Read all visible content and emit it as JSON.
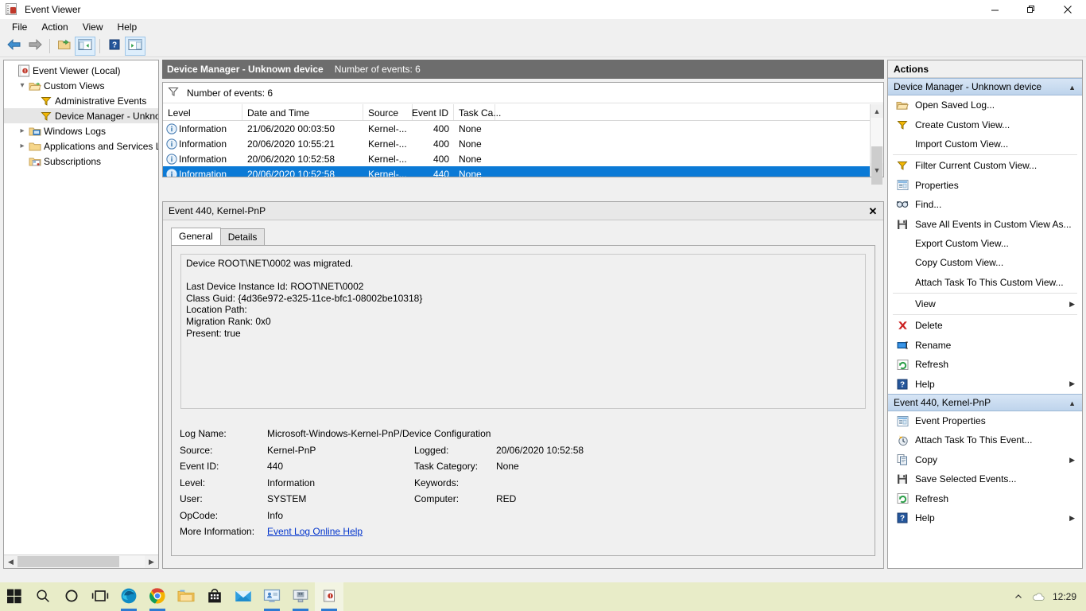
{
  "window": {
    "title": "Event Viewer",
    "icon": "event-viewer-icon",
    "controls": {
      "minimize": "minimize-icon",
      "restore": "restore-icon",
      "close": "close-icon"
    }
  },
  "menubar": {
    "items": [
      "File",
      "Action",
      "View",
      "Help"
    ]
  },
  "toolbar": {
    "buttons": [
      {
        "name": "back-button",
        "icon": "back-arrow-icon",
        "framed": false
      },
      {
        "name": "forward-button",
        "icon": "forward-arrow-icon",
        "framed": false
      },
      {
        "name": "up-folder-button",
        "icon": "folder-up-icon",
        "framed": false
      },
      {
        "name": "show-hide-console-tree-button",
        "icon": "console-tree-icon",
        "framed": true
      },
      {
        "name": "help-button",
        "icon": "help-icon",
        "framed": false
      },
      {
        "name": "show-hide-action-pane-button",
        "icon": "action-pane-icon",
        "framed": true
      }
    ]
  },
  "tree": {
    "items": [
      {
        "label": "Event Viewer (Local)",
        "indent": 0,
        "twisty": "",
        "icon": "event-viewer-icon",
        "selected": false
      },
      {
        "label": "Custom Views",
        "indent": 1,
        "twisty": "v",
        "icon": "folder-open-icon",
        "selected": false
      },
      {
        "label": "Administrative Events",
        "indent": 2,
        "twisty": "",
        "icon": "filter-icon",
        "selected": false
      },
      {
        "label": "Device Manager - Unkno",
        "indent": 2,
        "twisty": "",
        "icon": "filter-icon",
        "selected": true
      },
      {
        "label": "Windows Logs",
        "indent": 1,
        "twisty": ">",
        "icon": "logs-folder-icon",
        "selected": false
      },
      {
        "label": "Applications and Services Lo",
        "indent": 1,
        "twisty": ">",
        "icon": "folder-icon",
        "selected": false
      },
      {
        "label": "Subscriptions",
        "indent": 1,
        "twisty": "",
        "icon": "subscriptions-icon",
        "selected": false
      }
    ]
  },
  "center": {
    "header": {
      "title": "Device Manager - Unknown device",
      "subtitle": "Number of events: 6"
    },
    "filter_row": {
      "icon": "filter-icon",
      "text": "Number of events: 6"
    },
    "columns": [
      "Level",
      "Date and Time",
      "Source",
      "Event ID",
      "Task Ca..."
    ],
    "rows": [
      {
        "level": "Information",
        "datetime": "21/06/2020 00:03:50",
        "source": "Kernel-...",
        "event_id": "400",
        "task_category": "None",
        "selected": false
      },
      {
        "level": "Information",
        "datetime": "20/06/2020 10:55:21",
        "source": "Kernel-...",
        "event_id": "400",
        "task_category": "None",
        "selected": false
      },
      {
        "level": "Information",
        "datetime": "20/06/2020 10:52:58",
        "source": "Kernel-...",
        "event_id": "400",
        "task_category": "None",
        "selected": false
      },
      {
        "level": "Information",
        "datetime": "20/06/2020 10:52:58",
        "source": "Kernel-...",
        "event_id": "440",
        "task_category": "None",
        "selected": true
      }
    ]
  },
  "details": {
    "title": "Event 440, Kernel-PnP",
    "close_icon": "close-icon",
    "tabs": [
      {
        "label": "General",
        "active": true
      },
      {
        "label": "Details",
        "active": false
      }
    ],
    "message": "Device ROOT\\NET\\0002 was migrated.\n\nLast Device Instance Id: ROOT\\NET\\0002\nClass Guid: {4d36e972-e325-11ce-bfc1-08002be10318}\nLocation Path:\nMigration Rank: 0x0\nPresent: true",
    "fields": {
      "log_name_label": "Log Name:",
      "log_name_value": "Microsoft-Windows-Kernel-PnP/Device Configuration",
      "source_label": "Source:",
      "source_value": "Kernel-PnP",
      "logged_label": "Logged:",
      "logged_value": "20/06/2020 10:52:58",
      "event_id_label": "Event ID:",
      "event_id_value": "440",
      "task_category_label": "Task Category:",
      "task_category_value": "None",
      "level_label": "Level:",
      "level_value": "Information",
      "keywords_label": "Keywords:",
      "keywords_value": "",
      "user_label": "User:",
      "user_value": "SYSTEM",
      "computer_label": "Computer:",
      "computer_value": "RED",
      "opcode_label": "OpCode:",
      "opcode_value": "Info",
      "more_information_label": "More Information:",
      "more_information_link": "Event Log Online Help"
    }
  },
  "actions": {
    "header": "Actions",
    "groups": [
      {
        "title": "Device Manager - Unknown device",
        "chevron": "chevron-up-icon",
        "items": [
          {
            "label": "Open Saved Log...",
            "icon": "open-folder-icon",
            "submenu": false,
            "sep_after": false
          },
          {
            "label": "Create Custom View...",
            "icon": "filter-icon",
            "submenu": false,
            "sep_after": false
          },
          {
            "label": "Import Custom View...",
            "icon": "",
            "submenu": false,
            "sep_after": true
          },
          {
            "label": "Filter Current Custom View...",
            "icon": "filter-icon",
            "submenu": false,
            "sep_after": false
          },
          {
            "label": "Properties",
            "icon": "properties-icon",
            "submenu": false,
            "sep_after": false
          },
          {
            "label": "Find...",
            "icon": "find-icon",
            "submenu": false,
            "sep_after": false
          },
          {
            "label": "Save All Events in Custom View As...",
            "icon": "save-icon",
            "submenu": false,
            "sep_after": false
          },
          {
            "label": "Export Custom View...",
            "icon": "",
            "submenu": false,
            "sep_after": false
          },
          {
            "label": "Copy Custom View...",
            "icon": "",
            "submenu": false,
            "sep_after": false
          },
          {
            "label": "Attach Task To This Custom View...",
            "icon": "",
            "submenu": false,
            "sep_after": true
          },
          {
            "label": "View",
            "icon": "",
            "submenu": true,
            "sep_after": true
          },
          {
            "label": "Delete",
            "icon": "delete-icon",
            "submenu": false,
            "sep_after": false
          },
          {
            "label": "Rename",
            "icon": "rename-icon",
            "submenu": false,
            "sep_after": false
          },
          {
            "label": "Refresh",
            "icon": "refresh-icon",
            "submenu": false,
            "sep_after": false
          },
          {
            "label": "Help",
            "icon": "help-icon",
            "submenu": true,
            "sep_after": false
          }
        ]
      },
      {
        "title": "Event 440, Kernel-PnP",
        "chevron": "chevron-up-icon",
        "items": [
          {
            "label": "Event Properties",
            "icon": "properties-icon",
            "submenu": false,
            "sep_after": false
          },
          {
            "label": "Attach Task To This Event...",
            "icon": "attach-task-icon",
            "submenu": false,
            "sep_after": false
          },
          {
            "label": "Copy",
            "icon": "copy-icon",
            "submenu": true,
            "sep_after": false
          },
          {
            "label": "Save Selected Events...",
            "icon": "save-icon",
            "submenu": false,
            "sep_after": false
          },
          {
            "label": "Refresh",
            "icon": "refresh-icon",
            "submenu": false,
            "sep_after": false
          },
          {
            "label": "Help",
            "icon": "help-icon",
            "submenu": true,
            "sep_after": false
          }
        ]
      }
    ]
  },
  "taskbar": {
    "items": [
      {
        "name": "start-button",
        "icon": "windows-logo-icon",
        "active": false,
        "running": false
      },
      {
        "name": "search-button",
        "icon": "search-icon",
        "active": false,
        "running": false
      },
      {
        "name": "cortana-button",
        "icon": "circle-icon",
        "active": false,
        "running": false
      },
      {
        "name": "task-view-button",
        "icon": "task-view-icon",
        "active": false,
        "running": false
      },
      {
        "name": "taskbar-edge",
        "icon": "edge-icon",
        "active": false,
        "running": true
      },
      {
        "name": "taskbar-chrome",
        "icon": "chrome-icon",
        "active": false,
        "running": true
      },
      {
        "name": "taskbar-file-explorer",
        "icon": "file-explorer-icon",
        "active": false,
        "running": false
      },
      {
        "name": "taskbar-microsoft-store",
        "icon": "store-icon",
        "active": false,
        "running": false
      },
      {
        "name": "taskbar-mail",
        "icon": "mail-icon",
        "active": false,
        "running": false
      },
      {
        "name": "taskbar-remote-desktop",
        "icon": "remote-desktop-icon",
        "active": false,
        "running": true
      },
      {
        "name": "taskbar-device-manager",
        "icon": "device-manager-icon",
        "active": false,
        "running": true
      },
      {
        "name": "taskbar-event-viewer",
        "icon": "event-viewer-icon",
        "active": true,
        "running": true
      }
    ],
    "tray": {
      "chevron": "chevron-up-icon",
      "cloud": "onedrive-icon",
      "clock": "12:29"
    }
  },
  "colors": {
    "selection_blue": "#0b7ad6",
    "pane_header_gray": "#6d6d6d",
    "group_header_blue": "#bed4ec",
    "link_blue": "#0033cc",
    "taskbar": "#e8ecc8"
  }
}
